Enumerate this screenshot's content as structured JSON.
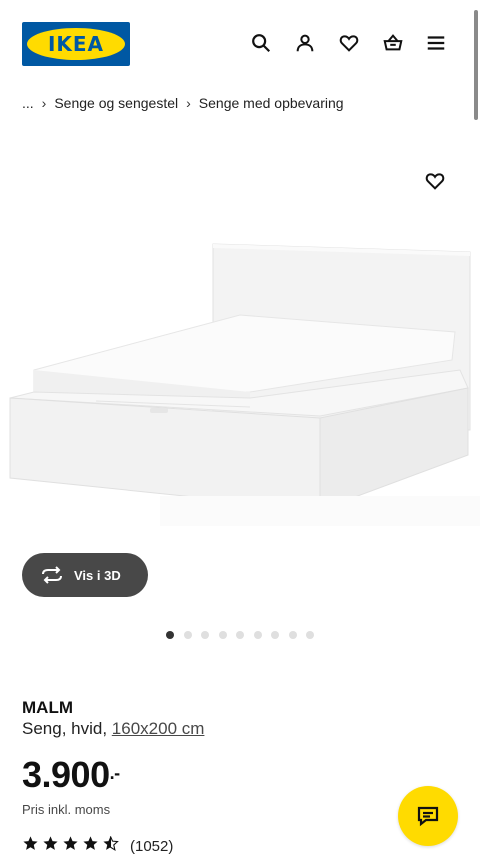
{
  "header": {
    "logo_text": "IKEA",
    "icons": [
      "search-icon",
      "user-icon",
      "heart-icon",
      "basket-icon",
      "menu-icon"
    ]
  },
  "breadcrumb": {
    "ellipsis": "...",
    "items": [
      "Senge og sengestel",
      "Senge med opbevaring"
    ]
  },
  "gallery": {
    "view_3d_label": "Vis i 3D",
    "dot_count": 9,
    "active_dot": 0
  },
  "product": {
    "name": "MALM",
    "description": "Seng, hvid,",
    "size_link": "160x200 cm",
    "price": "3.900",
    "price_suffix": ".-",
    "tax_note": "Pris inkl. moms",
    "rating_value": 4.5,
    "rating_count": "(1052)"
  },
  "colors": {
    "brand_blue": "#0058a3",
    "brand_yellow": "#ffdb00",
    "button_dark": "#484848"
  }
}
